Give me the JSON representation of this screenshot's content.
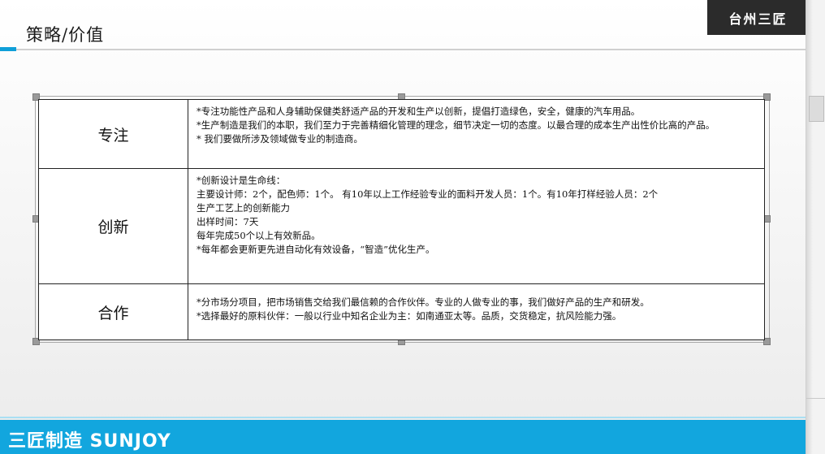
{
  "header": {
    "title": "策略/价值",
    "logo_text": "台州三匠"
  },
  "table": {
    "rows": [
      {
        "key": "专注",
        "lines": [
          "*专注功能性产品和人身辅助保健类舒适产品的开发和生产以创新，提倡打造绿色，安全，健康的汽车用品。",
          "*生产制造是我们的本职，我们至力于完善精细化管理的理念，细节决定一切的态度。以最合理的成本生产出性价比高的产品。",
          "* 我们要做所涉及领域做专业的制造商。"
        ]
      },
      {
        "key": "创新",
        "lines": [
          "*创新设计是生命线：",
          "主要设计师：2个，配色师：1个。 有10年以上工作经验专业的面料开发人员：1个。有10年打样经验人员：2个",
          "生产工艺上的创新能力",
          "出样时间：7天",
          "每年完成50个以上有效新品。",
          "*每年都会更新更先进自动化有效设备，“智造”优化生产。"
        ]
      },
      {
        "key": "合作",
        "lines": [
          "*分市场分项目，把市场销售交给我们最信赖的合作伙伴。专业的人做专业的事，我们做好产品的生产和研发。",
          "*选择最好的原料伙伴：一般以行业中知名企业为主：如南通亚太等。品质，交货稳定，抗风险能力强。"
        ]
      }
    ]
  },
  "footer": {
    "text": "三匠制造 SUNJOY"
  },
  "colors": {
    "accent": "#12a6de",
    "logo_bg": "#2b2b2b"
  }
}
